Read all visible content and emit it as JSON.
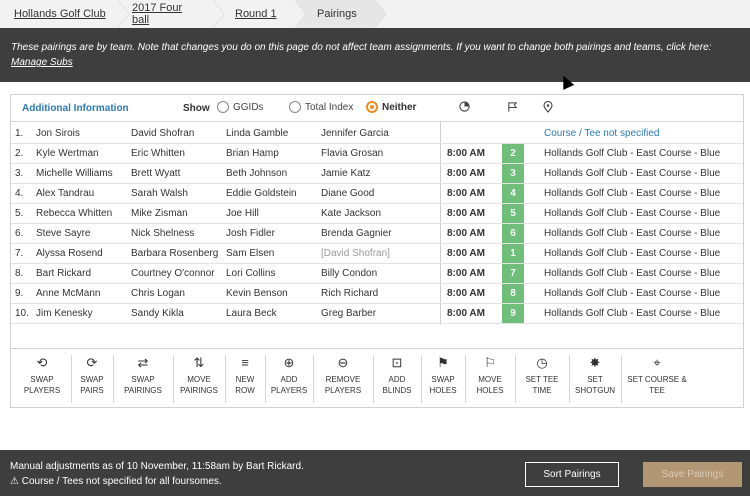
{
  "breadcrumb": {
    "items": [
      {
        "label": "Hollands Golf Club"
      },
      {
        "label": "2017 Four ball"
      },
      {
        "label": "Round 1"
      },
      {
        "label": "Pairings"
      }
    ]
  },
  "notice": {
    "text": "These pairings are by team. Note that changes you do on this page do not affect team assignments. If you want to change both pairings and teams, click here: ",
    "link": "Manage Subs"
  },
  "info": {
    "title": "Additional Information",
    "show_label": "Show",
    "options": [
      {
        "label": "GGIDs",
        "selected": false
      },
      {
        "label": "Total Index",
        "selected": false
      },
      {
        "label": "Neither",
        "selected": true
      }
    ],
    "icons": [
      "clock-pie-icon",
      "flag-icon",
      "location-pin-icon"
    ]
  },
  "pairings": [
    {
      "n": "1.",
      "p1": "Jon Sirois",
      "p2": "David Shofran",
      "p3": "Linda Gamble",
      "p4": "Jennifer Garcia",
      "time": "",
      "hole": "",
      "course": "Course / Tee not specified"
    },
    {
      "n": "2.",
      "p1": "Kyle Wertman",
      "p2": "Eric Whitten",
      "p3": "Brian Hamp",
      "p4": "Flavia Grosan",
      "time": "8:00 AM",
      "hole": "2",
      "course": "Hollands Golf Club - East Course - Blue"
    },
    {
      "n": "3.",
      "p1": "Michelle Williams",
      "p2": "Brett Wyatt",
      "p3": "Beth Johnson",
      "p4": "Jamie Katz",
      "time": "8:00 AM",
      "hole": "3",
      "course": "Hollands Golf Club - East Course - Blue"
    },
    {
      "n": "4.",
      "p1": "Alex Tandrau",
      "p2": "Sarah Walsh",
      "p3": "Eddie Goldstein",
      "p4": "Diane Good",
      "time": "8:00 AM",
      "hole": "4",
      "course": "Hollands Golf Club - East Course - Blue"
    },
    {
      "n": "5.",
      "p1": "Rebecca Whitten",
      "p2": "Mike Zisman",
      "p3": "Joe Hill",
      "p4": "Kate Jackson",
      "time": "8:00 AM",
      "hole": "5",
      "course": "Hollands Golf Club - East Course - Blue"
    },
    {
      "n": "6.",
      "p1": "Steve Sayre",
      "p2": "Nick Shelness",
      "p3": "Josh Fidler",
      "p4": "Brenda Gagnier",
      "time": "8:00 AM",
      "hole": "6",
      "course": "Hollands Golf Club - East Course - Blue"
    },
    {
      "n": "7.",
      "p1": "Alyssa Rosend",
      "p2": "Barbara Rosenberg",
      "p3": "Sam Elsen",
      "p4": "[David Shofran]",
      "time": "8:00 AM",
      "hole": "1",
      "course": "Hollands Golf Club - East Course - Blue"
    },
    {
      "n": "8.",
      "p1": "Bart Rickard",
      "p2": "Courtney O'connor",
      "p3": "Lori Collins",
      "p4": "Billy Condon",
      "time": "8:00 AM",
      "hole": "7",
      "course": "Hollands Golf Club - East Course - Blue"
    },
    {
      "n": "9.",
      "p1": "Anne McMann",
      "p2": "Chris Logan",
      "p3": "Kevin Benson",
      "p4": "Rich Richard",
      "time": "8:00 AM",
      "hole": "8",
      "course": "Hollands Golf Club - East Course - Blue"
    },
    {
      "n": "10.",
      "p1": "Jim Kenesky",
      "p2": "Sandy Kikla",
      "p3": "Laura Beck",
      "p4": "Greg Barber",
      "time": "8:00 AM",
      "hole": "9",
      "course": "Hollands Golf Club - East Course - Blue"
    }
  ],
  "toolbar": {
    "items": [
      {
        "l1": "SWAP",
        "l2": "PLAYERS",
        "icon": "swap-players-icon"
      },
      {
        "l1": "SWAP",
        "l2": "PAIRS",
        "icon": "swap-pairs-icon"
      },
      {
        "l1": "SWAP",
        "l2": "PAIRINGS",
        "icon": "swap-pairings-icon"
      },
      {
        "l1": "MOVE",
        "l2": "PAIRINGS",
        "icon": "move-pairings-icon"
      },
      {
        "l1": "NEW",
        "l2": "ROW",
        "icon": "new-row-icon"
      },
      {
        "l1": "ADD",
        "l2": "PLAYERS",
        "icon": "add-players-icon"
      },
      {
        "l1": "REMOVE",
        "l2": "PLAYERS",
        "icon": "remove-players-icon"
      },
      {
        "l1": "ADD",
        "l2": "BLINDS",
        "icon": "add-blinds-icon"
      },
      {
        "l1": "SWAP",
        "l2": "HOLES",
        "icon": "swap-holes-icon"
      },
      {
        "l1": "MOVE",
        "l2": "HOLES",
        "icon": "move-holes-icon"
      },
      {
        "l1": "SET TEE",
        "l2": "TIME",
        "icon": "clock-icon"
      },
      {
        "l1": "SET",
        "l2": "SHOTGUN",
        "icon": "shotgun-icon"
      },
      {
        "l1": "SET COURSE &",
        "l2": "TEE",
        "icon": "location-pin-icon"
      }
    ]
  },
  "footer": {
    "line1": "Manual adjustments as of 10 November, 11:58am by Bart Rickard.",
    "line2": "Course / Tees not specified for all foursomes.",
    "sort_label": "Sort Pairings",
    "save_label": "Save Pairings"
  },
  "colors": {
    "accent_blue": "#2a7ab5",
    "hole_green": "#6fbf7a",
    "radio_orange": "#f08c1f",
    "dark_bar": "#3e3e3e",
    "save_disabled": "#b39673"
  }
}
